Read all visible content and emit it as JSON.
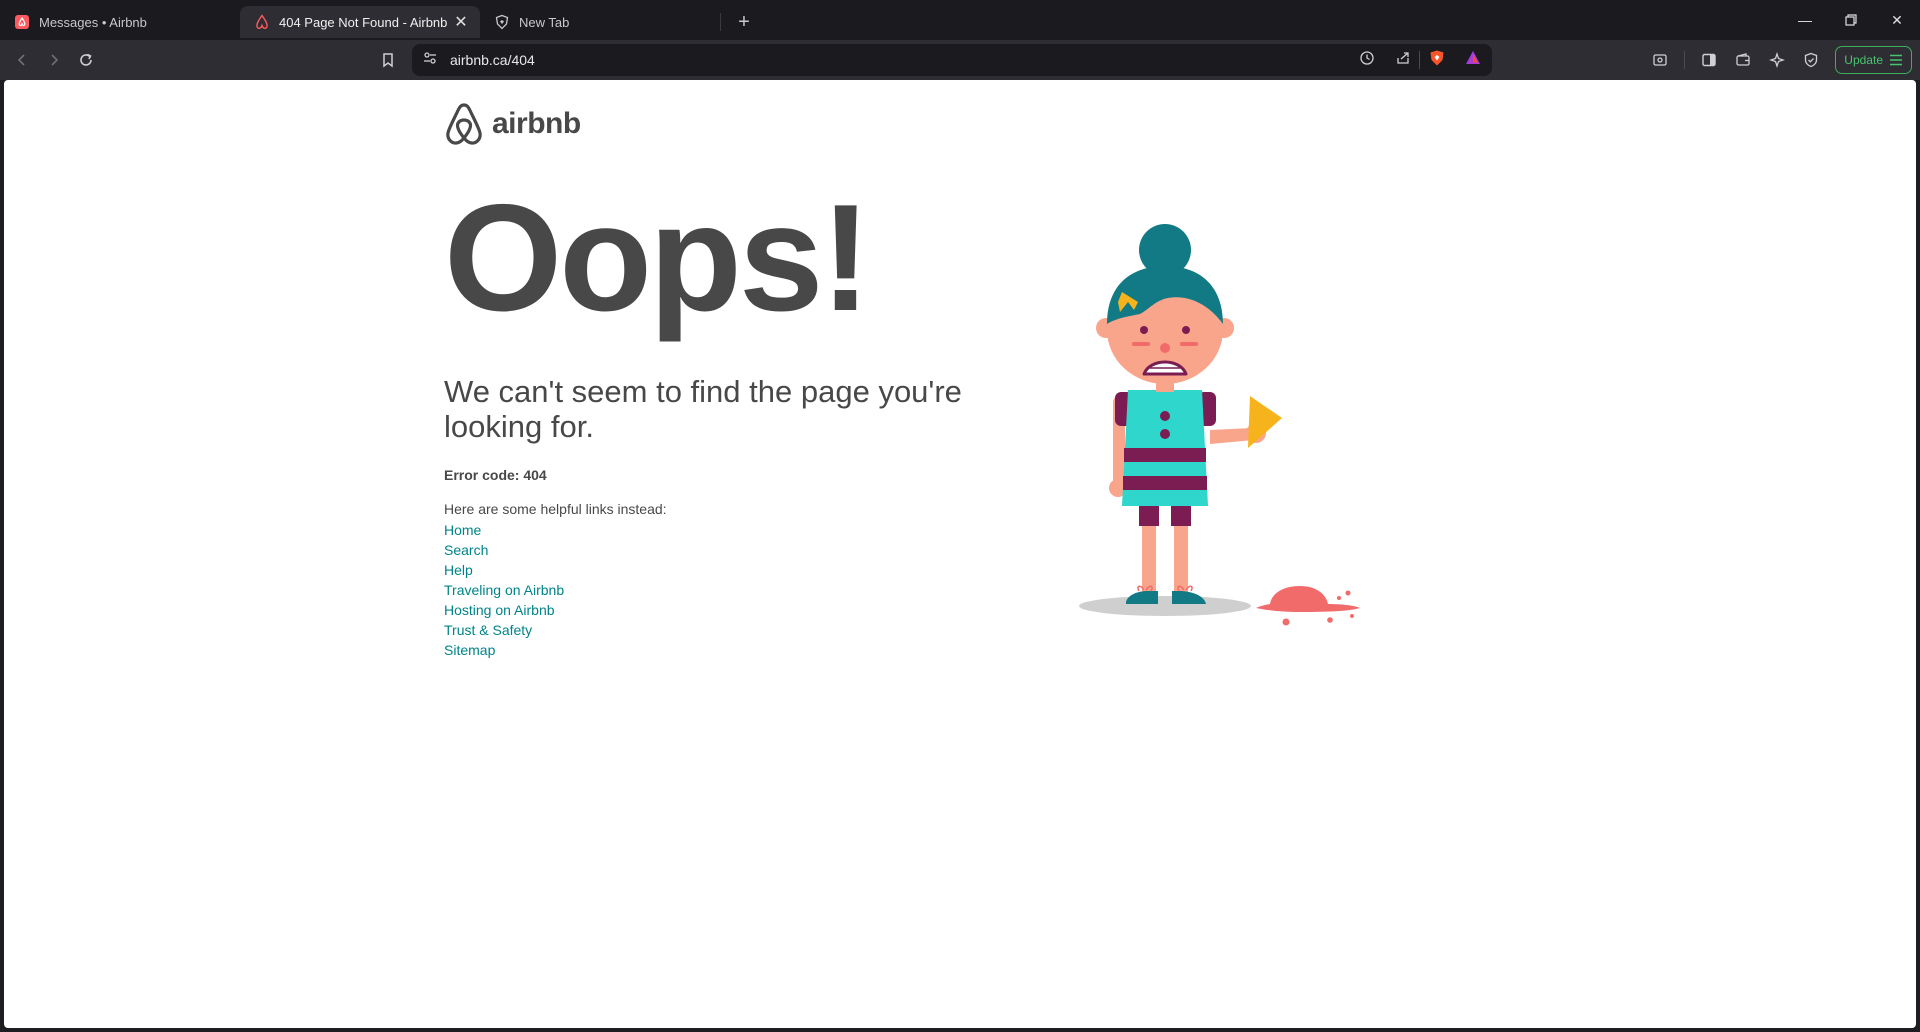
{
  "browser": {
    "tabs": [
      {
        "label": "Messages • Airbnb",
        "active": false
      },
      {
        "label": "404 Page Not Found - Airbnb",
        "active": true
      },
      {
        "label": "New Tab",
        "active": false
      }
    ],
    "url": "airbnb.ca/404",
    "update_label": "Update",
    "icons": [
      "back-icon",
      "forward-icon",
      "reload-icon",
      "bookmark-icon",
      "site-settings-icon",
      "history-icon",
      "share-icon",
      "brave-shields-icon",
      "brave-rewards-icon",
      "screenshot-icon",
      "sidebar-icon",
      "wallet-icon",
      "leo-ai-icon",
      "vpn-icon",
      "menu-icon"
    ]
  },
  "page": {
    "logo_text": "airbnb",
    "heading": "Oops!",
    "subtitle": "We can't seem to find the page you're looking for.",
    "error_code": "Error code: 404",
    "helpful_text": "Here are some helpful links instead:",
    "links": [
      "Home",
      "Search",
      "Help",
      "Traveling on Airbnb",
      "Hosting on Airbnb",
      "Trust & Safety",
      "Sitemap"
    ]
  },
  "colors": {
    "brand": "#FF5A5F",
    "link": "#008489",
    "text": "#484848",
    "update": "#48C46E"
  }
}
